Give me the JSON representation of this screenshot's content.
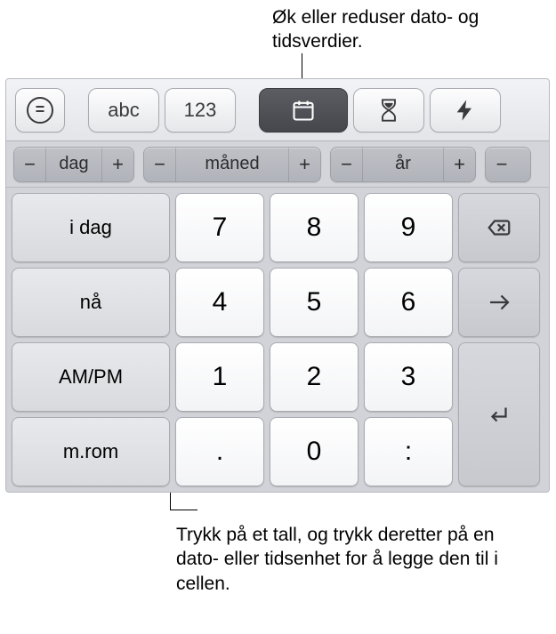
{
  "callouts": {
    "top": "Øk eller reduser dato- og tidsverdier.",
    "bottom": "Trykk på et tall, og trykk deretter på en dato- eller tidsenhet for å legge den til i cellen."
  },
  "toolbar": {
    "formula_symbol": "=",
    "abc_label": "abc",
    "num_label": "123"
  },
  "units": {
    "minus": "−",
    "plus": "+",
    "day": "dag",
    "month": "måned",
    "year": "år"
  },
  "leftKeys": {
    "today": "i dag",
    "now": "nå",
    "ampm": "AM/PM",
    "space": "m.rom"
  },
  "numpad": {
    "r1": [
      "7",
      "8",
      "9"
    ],
    "r2": [
      "4",
      "5",
      "6"
    ],
    "r3": [
      "1",
      "2",
      "3"
    ],
    "r4": [
      ".",
      "0",
      ":"
    ]
  }
}
